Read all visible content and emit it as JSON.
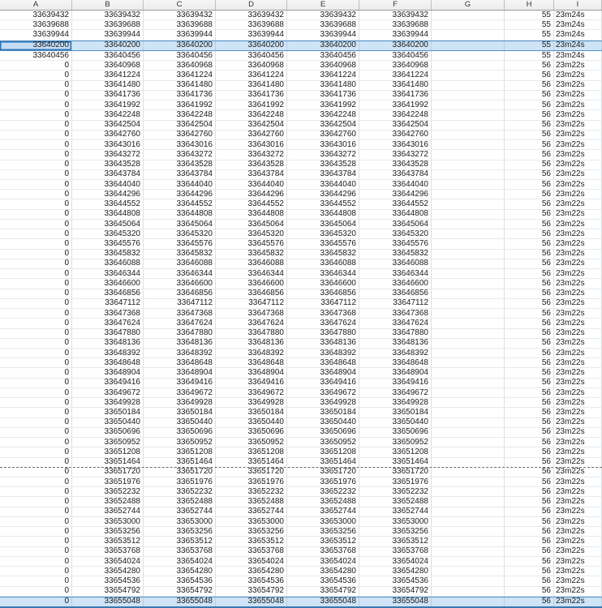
{
  "columns": [
    "A",
    "B",
    "C",
    "D",
    "E",
    "F",
    "G",
    "H",
    "I"
  ],
  "rows": [
    [
      "33639432",
      "33639432",
      "33639432",
      "33639432",
      "33639432",
      "33639432",
      "",
      "55",
      "23m24s"
    ],
    [
      "33639688",
      "33639688",
      "33639688",
      "33639688",
      "33639688",
      "33639688",
      "",
      "55",
      "23m24s"
    ],
    [
      "33639944",
      "33639944",
      "33639944",
      "33639944",
      "33639944",
      "33639944",
      "",
      "55",
      "23m24s"
    ],
    [
      "33640200",
      "33640200",
      "33640200",
      "33640200",
      "33640200",
      "33640200",
      "",
      "55",
      "23m24s"
    ],
    [
      "33640456",
      "33640456",
      "33640456",
      "33640456",
      "33640456",
      "33640456",
      "",
      "55",
      "23m24s"
    ],
    [
      "0",
      "33640968",
      "33640968",
      "33640968",
      "33640968",
      "33640968",
      "",
      "56",
      "23m22s"
    ],
    [
      "0",
      "33641224",
      "33641224",
      "33641224",
      "33641224",
      "33641224",
      "",
      "56",
      "23m22s"
    ],
    [
      "0",
      "33641480",
      "33641480",
      "33641480",
      "33641480",
      "33641480",
      "",
      "56",
      "23m22s"
    ],
    [
      "0",
      "33641736",
      "33641736",
      "33641736",
      "33641736",
      "33641736",
      "",
      "56",
      "23m22s"
    ],
    [
      "0",
      "33641992",
      "33641992",
      "33641992",
      "33641992",
      "33641992",
      "",
      "56",
      "23m22s"
    ],
    [
      "0",
      "33642248",
      "33642248",
      "33642248",
      "33642248",
      "33642248",
      "",
      "56",
      "23m22s"
    ],
    [
      "0",
      "33642504",
      "33642504",
      "33642504",
      "33642504",
      "33642504",
      "",
      "56",
      "23m22s"
    ],
    [
      "0",
      "33642760",
      "33642760",
      "33642760",
      "33642760",
      "33642760",
      "",
      "56",
      "23m22s"
    ],
    [
      "0",
      "33643016",
      "33643016",
      "33643016",
      "33643016",
      "33643016",
      "",
      "56",
      "23m22s"
    ],
    [
      "0",
      "33643272",
      "33643272",
      "33643272",
      "33643272",
      "33643272",
      "",
      "56",
      "23m22s"
    ],
    [
      "0",
      "33643528",
      "33643528",
      "33643528",
      "33643528",
      "33643528",
      "",
      "56",
      "23m22s"
    ],
    [
      "0",
      "33643784",
      "33643784",
      "33643784",
      "33643784",
      "33643784",
      "",
      "56",
      "23m22s"
    ],
    [
      "0",
      "33644040",
      "33644040",
      "33644040",
      "33644040",
      "33644040",
      "",
      "56",
      "23m22s"
    ],
    [
      "0",
      "33644296",
      "33644296",
      "33644296",
      "33644296",
      "33644296",
      "",
      "56",
      "23m22s"
    ],
    [
      "0",
      "33644552",
      "33644552",
      "33644552",
      "33644552",
      "33644552",
      "",
      "56",
      "23m22s"
    ],
    [
      "0",
      "33644808",
      "33644808",
      "33644808",
      "33644808",
      "33644808",
      "",
      "56",
      "23m22s"
    ],
    [
      "0",
      "33645064",
      "33645064",
      "33645064",
      "33645064",
      "33645064",
      "",
      "56",
      "23m22s"
    ],
    [
      "0",
      "33645320",
      "33645320",
      "33645320",
      "33645320",
      "33645320",
      "",
      "56",
      "23m22s"
    ],
    [
      "0",
      "33645576",
      "33645576",
      "33645576",
      "33645576",
      "33645576",
      "",
      "56",
      "23m22s"
    ],
    [
      "0",
      "33645832",
      "33645832",
      "33645832",
      "33645832",
      "33645832",
      "",
      "56",
      "23m22s"
    ],
    [
      "0",
      "33646088",
      "33646088",
      "33646088",
      "33646088",
      "33646088",
      "",
      "56",
      "23m22s"
    ],
    [
      "0",
      "33646344",
      "33646344",
      "33646344",
      "33646344",
      "33646344",
      "",
      "56",
      "23m22s"
    ],
    [
      "0",
      "33646600",
      "33646600",
      "33646600",
      "33646600",
      "33646600",
      "",
      "56",
      "23m22s"
    ],
    [
      "0",
      "33646856",
      "33646856",
      "33646856",
      "33646856",
      "33646856",
      "",
      "56",
      "23m22s"
    ],
    [
      "0",
      "33647112",
      "33647112",
      "33647112",
      "33647112",
      "33647112",
      "",
      "56",
      "23m22s"
    ],
    [
      "0",
      "33647368",
      "33647368",
      "33647368",
      "33647368",
      "33647368",
      "",
      "56",
      "23m22s"
    ],
    [
      "0",
      "33647624",
      "33647624",
      "33647624",
      "33647624",
      "33647624",
      "",
      "56",
      "23m22s"
    ],
    [
      "0",
      "33647880",
      "33647880",
      "33647880",
      "33647880",
      "33647880",
      "",
      "56",
      "23m22s"
    ],
    [
      "0",
      "33648136",
      "33648136",
      "33648136",
      "33648136",
      "33648136",
      "",
      "56",
      "23m22s"
    ],
    [
      "0",
      "33648392",
      "33648392",
      "33648392",
      "33648392",
      "33648392",
      "",
      "56",
      "23m22s"
    ],
    [
      "0",
      "33648648",
      "33648648",
      "33648648",
      "33648648",
      "33648648",
      "",
      "56",
      "23m22s"
    ],
    [
      "0",
      "33648904",
      "33648904",
      "33648904",
      "33648904",
      "33648904",
      "",
      "56",
      "23m22s"
    ],
    [
      "0",
      "33649416",
      "33649416",
      "33649416",
      "33649416",
      "33649416",
      "",
      "56",
      "23m22s"
    ],
    [
      "0",
      "33649672",
      "33649672",
      "33649672",
      "33649672",
      "33649672",
      "",
      "56",
      "23m22s"
    ],
    [
      "0",
      "33649928",
      "33649928",
      "33649928",
      "33649928",
      "33649928",
      "",
      "56",
      "23m22s"
    ],
    [
      "0",
      "33650184",
      "33650184",
      "33650184",
      "33650184",
      "33650184",
      "",
      "56",
      "23m22s"
    ],
    [
      "0",
      "33650440",
      "33650440",
      "33650440",
      "33650440",
      "33650440",
      "",
      "56",
      "23m22s"
    ],
    [
      "0",
      "33650696",
      "33650696",
      "33650696",
      "33650696",
      "33650696",
      "",
      "56",
      "23m22s"
    ],
    [
      "0",
      "33650952",
      "33650952",
      "33650952",
      "33650952",
      "33650952",
      "",
      "56",
      "23m22s"
    ],
    [
      "0",
      "33651208",
      "33651208",
      "33651208",
      "33651208",
      "33651208",
      "",
      "56",
      "23m22s"
    ],
    [
      "0",
      "33651464",
      "33651464",
      "33651464",
      "33651464",
      "33651464",
      "",
      "56",
      "23m22s"
    ],
    [
      "0",
      "33651720",
      "33651720",
      "33651720",
      "33651720",
      "33651720",
      "",
      "56",
      "23m22s"
    ],
    [
      "0",
      "33651976",
      "33651976",
      "33651976",
      "33651976",
      "33651976",
      "",
      "56",
      "23m22s"
    ],
    [
      "0",
      "33652232",
      "33652232",
      "33652232",
      "33652232",
      "33652232",
      "",
      "56",
      "23m22s"
    ],
    [
      "0",
      "33652488",
      "33652488",
      "33652488",
      "33652488",
      "33652488",
      "",
      "56",
      "23m22s"
    ],
    [
      "0",
      "33652744",
      "33652744",
      "33652744",
      "33652744",
      "33652744",
      "",
      "56",
      "23m22s"
    ],
    [
      "0",
      "33653000",
      "33653000",
      "33653000",
      "33653000",
      "33653000",
      "",
      "56",
      "23m22s"
    ],
    [
      "0",
      "33653256",
      "33653256",
      "33653256",
      "33653256",
      "33653256",
      "",
      "56",
      "23m22s"
    ],
    [
      "0",
      "33653512",
      "33653512",
      "33653512",
      "33653512",
      "33653512",
      "",
      "56",
      "23m22s"
    ],
    [
      "0",
      "33653768",
      "33653768",
      "33653768",
      "33653768",
      "33653768",
      "",
      "56",
      "23m22s"
    ],
    [
      "0",
      "33654024",
      "33654024",
      "33654024",
      "33654024",
      "33654024",
      "",
      "56",
      "23m22s"
    ],
    [
      "0",
      "33654280",
      "33654280",
      "33654280",
      "33654280",
      "33654280",
      "",
      "56",
      "23m22s"
    ],
    [
      "0",
      "33654536",
      "33654536",
      "33654536",
      "33654536",
      "33654536",
      "",
      "56",
      "23m22s"
    ],
    [
      "0",
      "33654792",
      "33654792",
      "33654792",
      "33654792",
      "33654792",
      "",
      "56",
      "23m22s"
    ],
    [
      "0",
      "33655048",
      "33655048",
      "33655048",
      "33655048",
      "33655048",
      "",
      "56",
      "23m22s"
    ]
  ],
  "selection": {
    "highlighted_row_indices": [
      3,
      59
    ],
    "active_cell_row_index": 3,
    "active_cell_column_index": 0,
    "selection_fill_color": "#cfe4f6",
    "selection_border_color": "#4e8fc7",
    "active_cell_border_color": "#2f74b8"
  },
  "page_break": {
    "after_row_index": 45,
    "line_style": "dashed"
  }
}
